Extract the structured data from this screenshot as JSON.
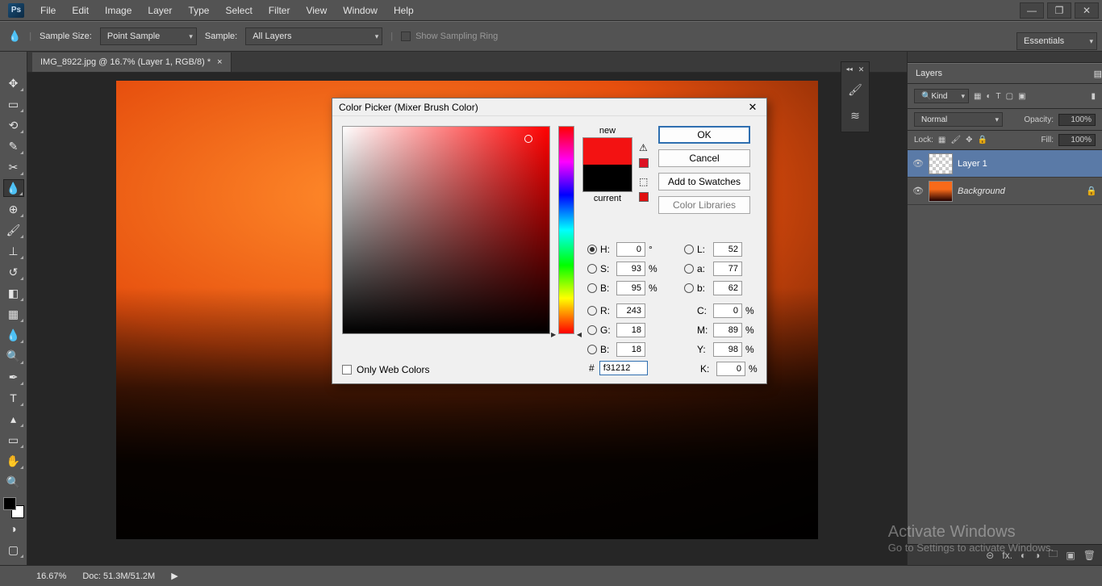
{
  "app": {
    "logo_text": "Ps"
  },
  "menu": {
    "items": [
      "File",
      "Edit",
      "Image",
      "Layer",
      "Type",
      "Select",
      "Filter",
      "View",
      "Window",
      "Help"
    ]
  },
  "optionsbar": {
    "eyedropper_icon": "⤡",
    "sample_size_label": "Sample Size:",
    "sample_size_value": "Point Sample",
    "sample_label": "Sample:",
    "sample_value": "All Layers",
    "sampling_ring_label": "Show Sampling Ring"
  },
  "workspace_switcher": "Essentials",
  "document_tab": {
    "title": "IMG_8922.jpg @ 16.7% (Layer 1, RGB/8) *"
  },
  "status": {
    "zoom": "16.67%",
    "doc": "Doc: 51.3M/51.2M"
  },
  "layers_panel": {
    "title": "Layers",
    "kind_label": "Kind",
    "blend_mode": "Normal",
    "opacity_label": "Opacity:",
    "opacity_value": "100%",
    "lock_label": "Lock:",
    "fill_label": "Fill:",
    "fill_value": "100%",
    "layers": [
      {
        "name": "Layer 1",
        "selected": true,
        "locked": false,
        "italic": false
      },
      {
        "name": "Background",
        "selected": false,
        "locked": true,
        "italic": true
      }
    ]
  },
  "color_picker": {
    "title": "Color Picker (Mixer Brush Color)",
    "new_label": "new",
    "current_label": "current",
    "ok": "OK",
    "cancel": "Cancel",
    "add_swatch": "Add to Swatches",
    "color_libs": "Color Libraries",
    "only_web": "Only Web Colors",
    "hex_prefix": "#",
    "hex_value": "f31212",
    "hsb": {
      "H": "0",
      "S": "93",
      "B": "95"
    },
    "lab": {
      "L": "52",
      "a": "77",
      "b": "62"
    },
    "rgb": {
      "R": "243",
      "G": "18",
      "B": "18"
    },
    "cmyk": {
      "C": "0",
      "M": "89",
      "Y": "98",
      "K": "0"
    },
    "degree": "°",
    "percent": "%",
    "new_color": "#f31212",
    "current_color": "#000000",
    "marker": {
      "left_pct": 90,
      "top_pct": 6
    },
    "hue_pos_pct": 99
  },
  "watermark": {
    "line1": "Activate Windows",
    "line2": "Go to Settings to activate Windows."
  },
  "window_controls": {
    "min": "—",
    "max": "❐",
    "close": "✕"
  }
}
